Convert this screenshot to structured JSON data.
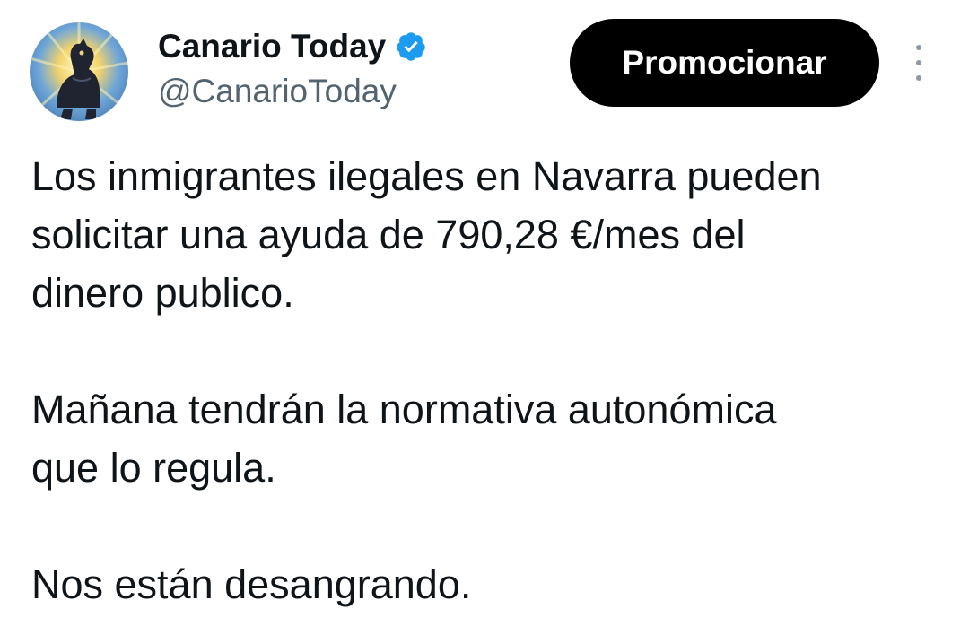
{
  "author": {
    "display_name": "Canario Today",
    "handle": "@CanarioToday",
    "verified_icon": "verified-badge-icon",
    "verified_color": "#1d9bf0",
    "avatar_icon": "dog-avatar-icon"
  },
  "actions": {
    "promote_label": "Promocionar",
    "more_icon": "more-vertical-icon"
  },
  "tweet": {
    "paragraphs": [
      "Los inmigrantes ilegales en Navarra pueden\nsolicitar una ayuda de 790,28 €/mes del\ndinero publico.",
      "Mañana tendrán la normativa autonómica\nque lo regula.",
      "Nos están desangrando."
    ]
  }
}
